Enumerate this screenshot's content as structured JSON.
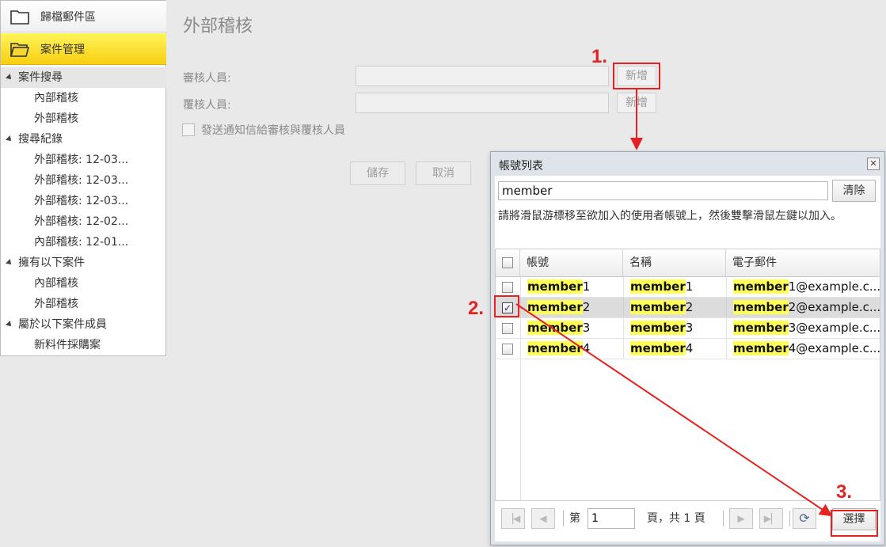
{
  "sidebar": {
    "nav": {
      "archive_label": "歸檔郵件區",
      "case_mgmt_label": "案件管理"
    },
    "groups": [
      {
        "label": "案件搜尋",
        "children": [
          "內部稽核",
          "外部稽核"
        ]
      },
      {
        "label": "搜尋紀錄",
        "children": [
          "外部稽核: 12-03...",
          "外部稽核: 12-03...",
          "外部稽核: 12-03...",
          "外部稽核: 12-02...",
          "內部稽核: 12-01..."
        ]
      },
      {
        "label": "擁有以下案件",
        "children": [
          "內部稽核",
          "外部稽核"
        ]
      },
      {
        "label": "屬於以下案件成員",
        "children": [
          "新料件採購案"
        ]
      }
    ]
  },
  "form": {
    "title": "外部稽核",
    "reviewer_label": "審核人員:",
    "rechecker_label": "覆核人員:",
    "add_label": "新增",
    "notify_label": "發送通知信給審核與覆核人員",
    "save_label": "儲存",
    "cancel_label": "取消"
  },
  "dialog": {
    "title": "帳號列表",
    "close_glyph": "✕",
    "search_value": "member",
    "clear_label": "清除",
    "hint": "請將滑鼠游標移至欲加入的使用者帳號上，然後雙擊滑鼠左鍵以加入。",
    "columns": [
      "帳號",
      "名稱",
      "電子郵件"
    ],
    "rows": [
      {
        "account_hl": "member",
        "account_rest": "1",
        "name_hl": "member",
        "name_rest": "1",
        "email_hl": "member",
        "email_rest": "1@example.c...",
        "checked": false
      },
      {
        "account_hl": "member",
        "account_rest": "2",
        "name_hl": "member",
        "name_rest": "2",
        "email_hl": "member",
        "email_rest": "2@example.c...",
        "checked": true
      },
      {
        "account_hl": "member",
        "account_rest": "3",
        "name_hl": "member",
        "name_rest": "3",
        "email_hl": "member",
        "email_rest": "3@example.c...",
        "checked": false
      },
      {
        "account_hl": "member",
        "account_rest": "4",
        "name_hl": "member",
        "name_rest": "4",
        "email_hl": "member",
        "email_rest": "4@example.c...",
        "checked": false
      }
    ],
    "pager": {
      "page_prefix": "第",
      "page_value": "1",
      "page_suffix": "頁，共 1 頁",
      "select_label": "選擇"
    }
  },
  "annotations": {
    "step1": "1.",
    "step2": "2.",
    "step3": "3.",
    "color": "#e52222"
  },
  "icons": {
    "folder": "folder-icon",
    "folder_open": "folder-open-icon",
    "first": "first-page-icon",
    "prev": "prev-page-icon",
    "next": "next-page-icon",
    "last": "last-page-icon",
    "refresh": "refresh-icon",
    "check": "✓"
  }
}
